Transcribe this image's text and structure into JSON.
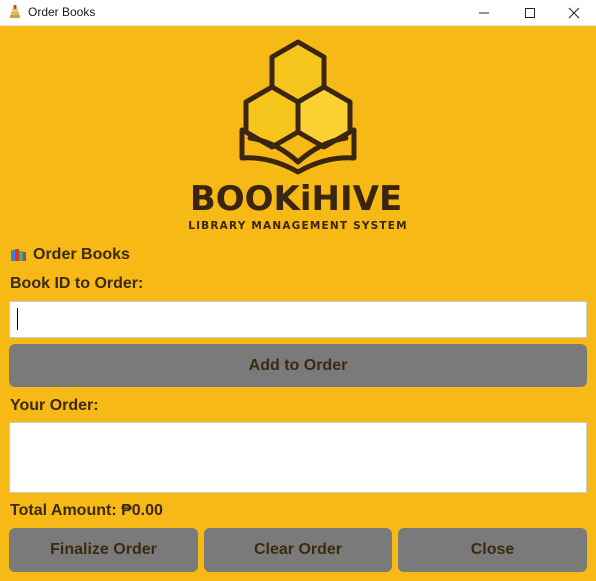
{
  "window": {
    "title": "Order Books",
    "icon": "book-stack-icon"
  },
  "brand": {
    "name": "BOOKiHIVE",
    "tagline": "LIBRARY MANAGEMENT SYSTEM",
    "logo_icon": "hive-book-logo"
  },
  "section": {
    "title": "Order Books",
    "icon": "books-icon"
  },
  "form": {
    "book_id_label": "Book ID to Order:",
    "book_id_value": "",
    "add_button": "Add to Order",
    "your_order_label": "Your Order:",
    "total_label": "Total Amount: ₱0.00"
  },
  "actions": {
    "finalize": "Finalize Order",
    "clear": "Clear Order",
    "close": "Close"
  },
  "colors": {
    "background": "#f7b916",
    "button": "#7a7a7a",
    "text": "#3a2a0f"
  }
}
